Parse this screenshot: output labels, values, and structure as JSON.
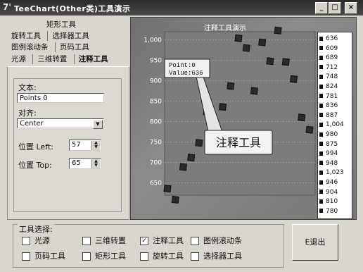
{
  "window": {
    "title": "TeeChart(Other类)工具演示",
    "app_icon_glyph": "7'",
    "minimize": "_",
    "maximize": "□",
    "close": "×"
  },
  "tabs": {
    "row1": [
      "矩形工具"
    ],
    "row2": [
      "旋转工具",
      "选择器工具"
    ],
    "row3": [
      "图例滚动条",
      "页码工具"
    ],
    "row4": [
      "光源",
      "三维转置",
      "注释工具"
    ],
    "active": "注释工具"
  },
  "form": {
    "text_label": "文本:",
    "text_value": "Points  0",
    "align_label": "对齐:",
    "align_value": "Center",
    "left_label": "位置 Left:",
    "left_value": "57",
    "top_label": "位置 Top:",
    "top_value": "65"
  },
  "chart_data": {
    "type": "scatter",
    "title": "注释工具演示",
    "y_tick_labels": [
      "1,000",
      "950",
      "900",
      "850",
      "800",
      "750",
      "700",
      "650"
    ],
    "ylim": [
      620,
      1020
    ],
    "series": [
      {
        "name": "",
        "values": [
          636,
          609,
          689,
          712,
          748,
          824,
          781,
          836,
          887,
          1004,
          980,
          875,
          994,
          948,
          1023,
          946,
          904,
          810,
          780
        ]
      }
    ],
    "annotation_box": {
      "line1": "Point:0",
      "line2": "Value:636"
    },
    "callout": "注释工具",
    "legend": [
      "636",
      "609",
      "689",
      "712",
      "748",
      "824",
      "781",
      "836",
      "887",
      "1,004",
      "980",
      "875",
      "994",
      "948",
      "1,023",
      "946",
      "904",
      "810",
      "780"
    ],
    "grid": true
  },
  "tools": {
    "group_label": "工具选择:",
    "items": [
      {
        "label": "光源",
        "checked": false
      },
      {
        "label": "三维转置",
        "checked": false
      },
      {
        "label": "注释工具",
        "checked": true
      },
      {
        "label": "图例滚动条",
        "checked": false
      },
      {
        "label": "页码工具",
        "checked": false
      },
      {
        "label": "矩形工具",
        "checked": false
      },
      {
        "label": "旋转工具",
        "checked": false
      },
      {
        "label": "选择器工具",
        "checked": false
      }
    ],
    "check_mark": "✓"
  },
  "exit_button": "E退出"
}
